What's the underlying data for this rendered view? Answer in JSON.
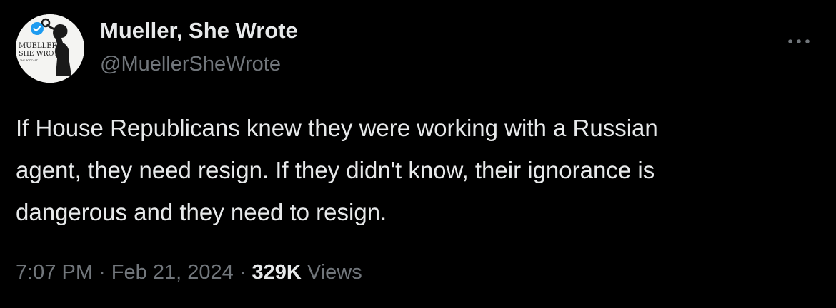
{
  "author": {
    "display_name": "Mueller, She Wrote",
    "handle": "@MuellerSheWrote",
    "avatar_lines": [
      "MUELLER,",
      "SHE WROTE",
      "THE PODCAST"
    ],
    "verified": true,
    "badge_color": "#1d9bf0"
  },
  "tweet": {
    "text": "If House Republicans knew they were working with a Russian\nagent, they need resign. If they didn't know, their ignorance is\ndangerous and they need to resign."
  },
  "meta": {
    "time": "7:07 PM",
    "separator": "·",
    "date": "Feb 21, 2024",
    "views_count": "329K",
    "views_label": "Views"
  },
  "icons": {
    "more": "more-horizontal-icon",
    "verified": "verified-badge-icon"
  },
  "colors": {
    "background": "#000000",
    "primary_text": "#e7e9ea",
    "secondary_text": "#71767b"
  }
}
